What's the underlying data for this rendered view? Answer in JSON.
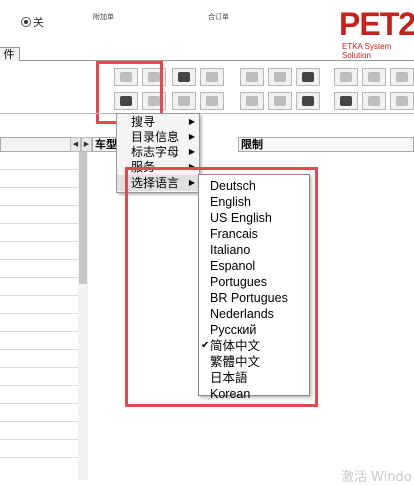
{
  "top": {
    "close_label": "关",
    "tiny_label_1": "附加单",
    "tiny_label_2": "合订单",
    "logo_text": "PET2",
    "logo_sub": "ETKA System Solution"
  },
  "tabs": [
    {
      "label": "件"
    }
  ],
  "columns": [
    {
      "label": "车型"
    },
    {
      "label": "限制"
    }
  ],
  "context_menu": {
    "items": [
      {
        "label": "搜寻",
        "has_submenu": true
      },
      {
        "label": "目录信息",
        "has_submenu": true
      },
      {
        "label": "标志字母",
        "has_submenu": true
      },
      {
        "label": "服务",
        "has_submenu": true
      },
      {
        "label": "选择语言",
        "has_submenu": true
      }
    ]
  },
  "language_menu": {
    "items": [
      {
        "label": "Deutsch",
        "checked": false
      },
      {
        "label": "English",
        "checked": false
      },
      {
        "label": "US English",
        "checked": false
      },
      {
        "label": "Francais",
        "checked": false
      },
      {
        "label": "Italiano",
        "checked": false
      },
      {
        "label": "Espanol",
        "checked": false
      },
      {
        "label": "Portugues",
        "checked": false
      },
      {
        "label": "BR Portugues",
        "checked": false
      },
      {
        "label": "Nederlands",
        "checked": false
      },
      {
        "label": "Русский",
        "checked": false
      },
      {
        "label": "简体中文",
        "checked": true
      },
      {
        "label": "繁體中文",
        "checked": false
      },
      {
        "label": "日本語",
        "checked": false
      },
      {
        "label": "Korean",
        "checked": false
      }
    ]
  },
  "watermark": "激活 Windo",
  "colors": {
    "highlight": "#e24a4f",
    "brand": "#c4221d"
  },
  "icons": [
    "print-icon",
    "person-icon",
    "dog-icon",
    "binoculars-icon",
    "pfwdb-icon",
    "dsfdt-icon",
    "cart-arrow-icon",
    "pin-icon",
    "prev-page-icon",
    "next-page-icon",
    "book-icon",
    "keyboard-icon",
    "camera-icon",
    "car-icon",
    "arrow-in-icon",
    "box-icon",
    "box-remove-icon",
    "cart-icon",
    "first-page-icon",
    "last-page-icon"
  ]
}
